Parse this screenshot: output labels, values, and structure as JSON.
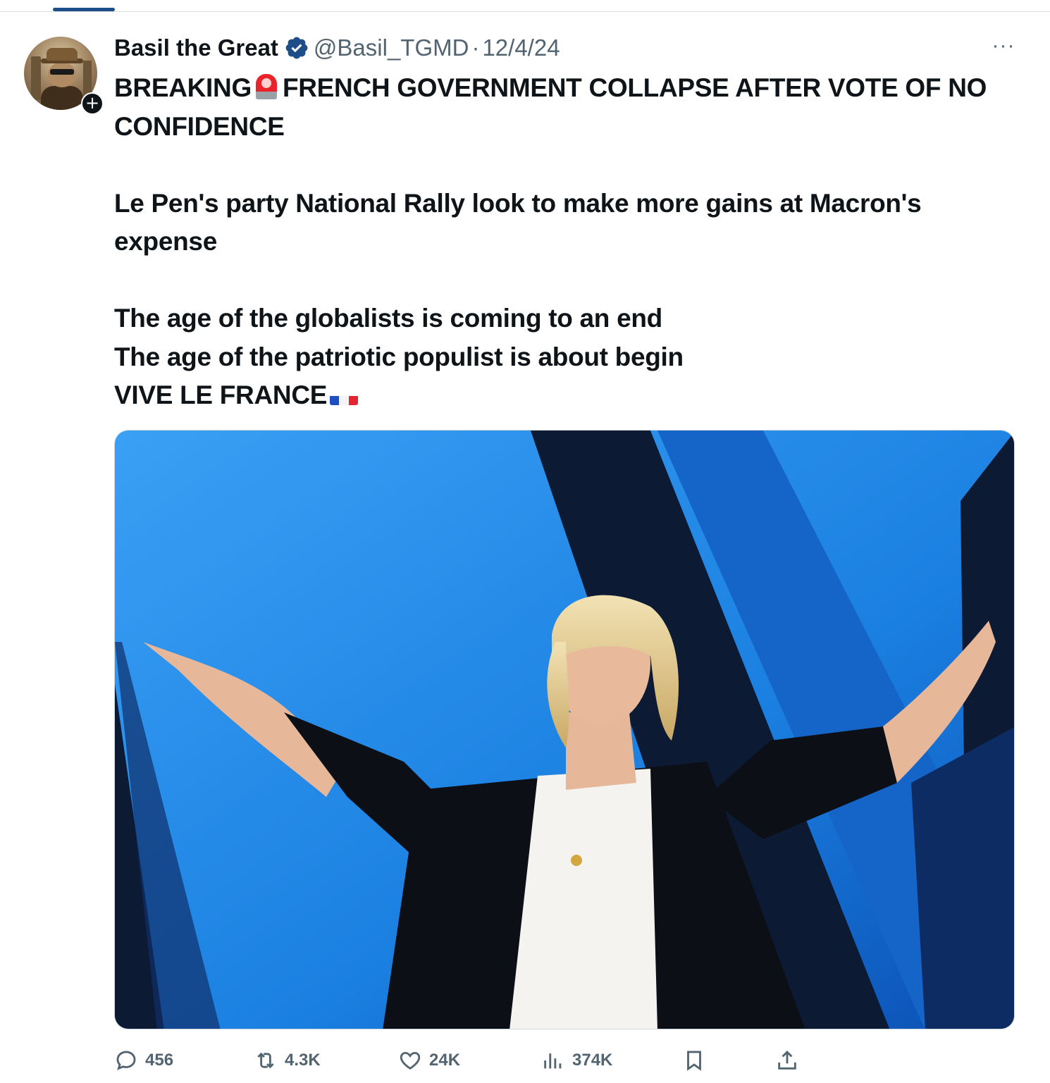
{
  "author": {
    "name": "Basil the Great",
    "handle": "@Basil_TGMD",
    "separator": "·",
    "date": "12/4/24",
    "verified": true
  },
  "tweet": {
    "line1": "BREAKING",
    "line1_rest": "FRENCH GOVERNMENT COLLAPSE AFTER VOTE OF NO CONFIDENCE",
    "line2": "Le Pen's party National Rally look to make more gains at Macron's expense",
    "line3": "The age of the globalists is coming to an end",
    "line4": "The age of the patriotic populist is about begin",
    "line5": "VIVE LE FRANCE"
  },
  "media": {
    "alt_icon": "photo-of-woman-with-arms-outstretched"
  },
  "actions": {
    "replies": "456",
    "reposts": "4.3K",
    "likes": "24K",
    "views": "374K"
  },
  "colors": {
    "text": "#0f1419",
    "secondary": "#536471",
    "verified": "#1d4e89",
    "stage_blue": "#1a7fe0"
  }
}
